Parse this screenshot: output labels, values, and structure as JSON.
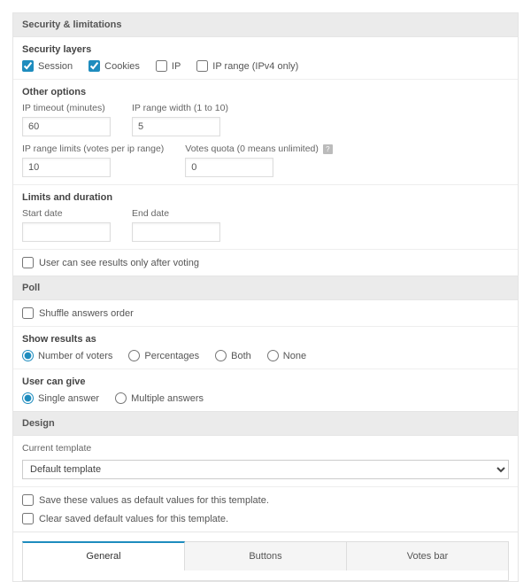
{
  "security": {
    "header": "Security & limitations",
    "layers_head": "Security layers",
    "layers": {
      "session": "Session",
      "cookies": "Cookies",
      "ip": "IP",
      "ip_range": "IP range (IPv4 only)"
    },
    "other_head": "Other options",
    "fields": {
      "ip_timeout": {
        "label": "IP timeout (minutes)",
        "value": "60"
      },
      "ip_range_width": {
        "label": "IP range width (1 to 10)",
        "value": "5"
      },
      "ip_range_limits": {
        "label": "IP range limits (votes per ip range)",
        "value": "10"
      },
      "votes_quota": {
        "label": "Votes quota (0 means unlimited)",
        "value": "0"
      }
    },
    "limits_head": "Limits and duration",
    "start_date": "Start date",
    "end_date": "End date",
    "after_voting": "User can see results only after voting"
  },
  "poll": {
    "header": "Poll",
    "shuffle": "Shuffle answers order",
    "show_results_head": "Show results as",
    "results": {
      "voters": "Number of voters",
      "percentages": "Percentages",
      "both": "Both",
      "none": "None"
    },
    "user_give_head": "User can give",
    "answers": {
      "single": "Single answer",
      "multiple": "Multiple answers"
    }
  },
  "design": {
    "header": "Design",
    "current_template": "Current template",
    "template_value": "Default template",
    "save_defaults": "Save these values as default values for this template.",
    "clear_defaults": "Clear saved default values for this template.",
    "tabs": {
      "general": "General",
      "buttons": "Buttons",
      "votes_bar": "Votes bar"
    }
  }
}
